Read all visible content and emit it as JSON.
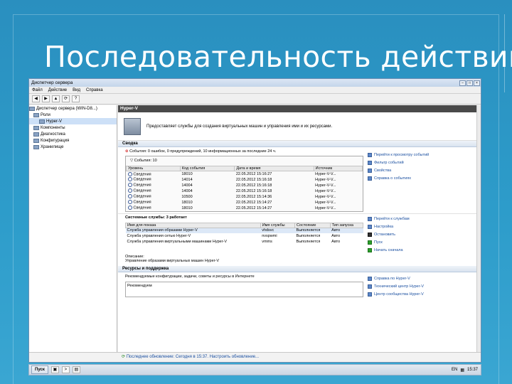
{
  "slide": {
    "title": "Последовательность действий"
  },
  "window": {
    "title": "Диспетчер сервера",
    "menu": [
      "Файл",
      "Действие",
      "Вид",
      "Справка"
    ],
    "tree": [
      "Диспетчер сервера (WIN-D8...)",
      "Роли",
      "Hyper-V",
      "Компоненты",
      "Диагностика",
      "Конфигурация",
      "Хранилище"
    ],
    "header": "Hyper-V",
    "intro": "Предоставляет службы для создания виртуальных машин и управления ими и их ресурсами.",
    "sections": {
      "summary": "Сводка",
      "system_services": "Системные службы: 3 работает",
      "resources": "Ресурсы и поддержка"
    },
    "events": {
      "line": "События: 0 ошибок, 0 предупреждений, 10 информационных за последние 24 ч.",
      "filter": "События: 10",
      "columns": [
        "Уровень",
        "Код события",
        "Дата и время",
        "Источник"
      ],
      "rows": [
        [
          "Сведения",
          "18010",
          "22.05.2012 15:16:27",
          "Hyper-V-V..."
        ],
        [
          "Сведения",
          "14014",
          "22.05.2012 15:16:18",
          "Hyper-V-V..."
        ],
        [
          "Сведения",
          "14004",
          "22.05.2012 15:16:18",
          "Hyper-V-V..."
        ],
        [
          "Сведения",
          "14004",
          "22.05.2012 15:16:18",
          "Hyper-V-V..."
        ],
        [
          "Сведения",
          "10500",
          "22.05.2012 15:14:36",
          "Hyper-V-V..."
        ],
        [
          "Сведения",
          "18010",
          "22.05.2012 15:14:27",
          "Hyper-V-V..."
        ],
        [
          "Сведения",
          "18010",
          "22.05.2012 15:14:27",
          "Hyper-V-V..."
        ]
      ]
    },
    "event_actions": [
      "Перейти к просмотру событий",
      "Фильтр событий",
      "Свойства",
      "Справка о событиях"
    ],
    "services": {
      "columns": [
        "Имя для показа",
        "Имя службы",
        "Состояние",
        "Тип запуска"
      ],
      "rows": [
        [
          "Служба управления образами Hyper-V",
          "vhdsvc",
          "Выполняется",
          "Авто"
        ],
        [
          "Служба управления сетью Hyper-V",
          "nvspwmi",
          "Выполняется",
          "Авто"
        ],
        [
          "Служба управления виртуальными машинами Hyper-V",
          "vmms",
          "Выполняется",
          "Авто"
        ]
      ],
      "desc_label": "Описание:",
      "desc": "Управление образами виртуальных машин Hyper-V"
    },
    "service_actions": [
      "Перейти к службам",
      "Настройка",
      "Остановить",
      "Пуск",
      "Начать сначала"
    ],
    "resources": {
      "line": "Рекомендуемые конфигурации, задачи, советы и ресурсы в Интернете",
      "label": "Рекомендуем"
    },
    "resource_actions": [
      "Справка по Hyper-V",
      "Технический центр Hyper-V",
      "Центр сообщества Hyper-V"
    ],
    "status": "Последнее обновление: Сегодня в 15:37. Настроить обновление..."
  },
  "taskbar": {
    "start": "Пуск",
    "lang": "EN",
    "time": "15:37"
  }
}
